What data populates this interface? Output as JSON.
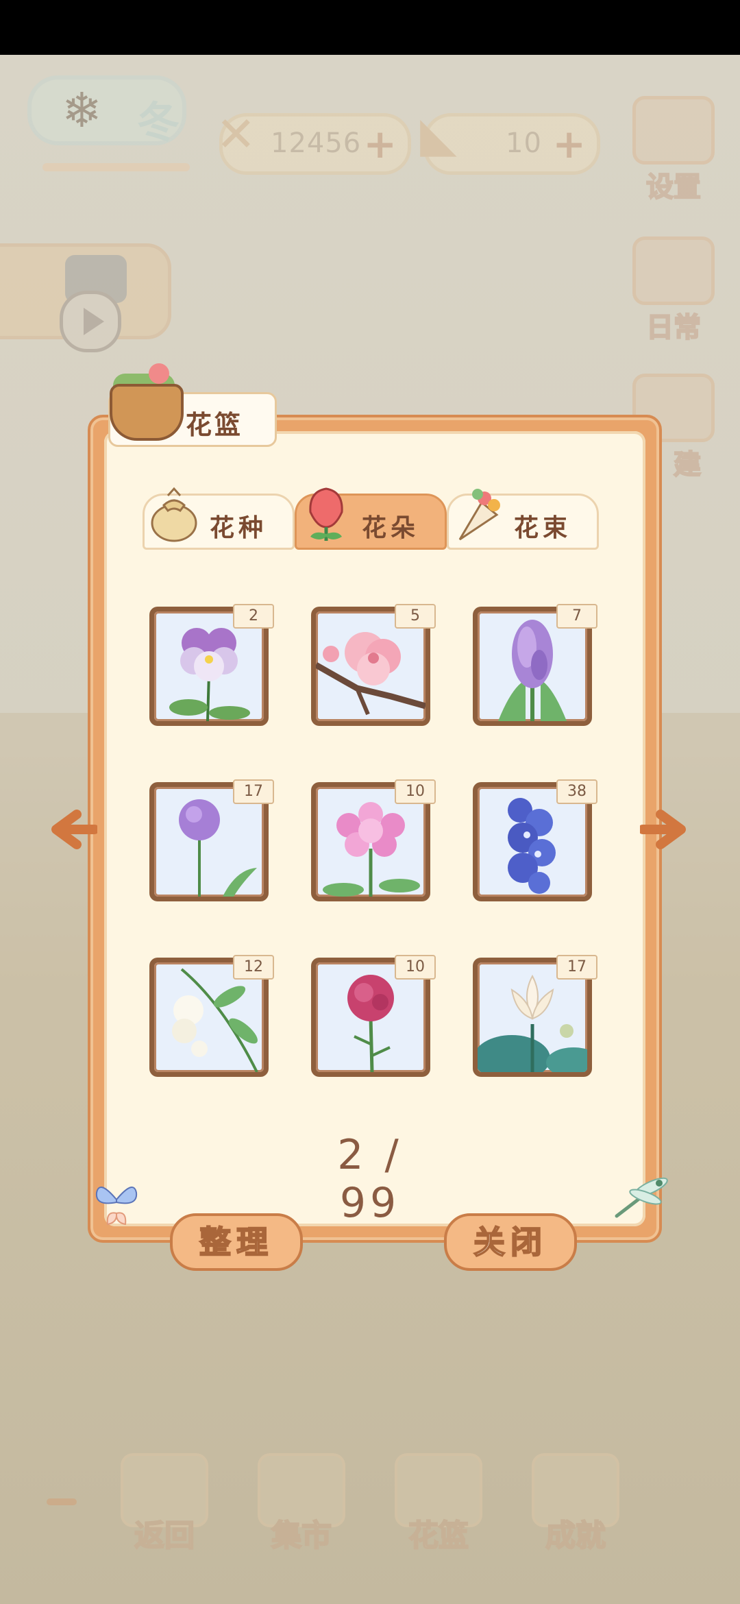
{
  "hud": {
    "season": "冬",
    "fish_count": "12456",
    "cheese_count": "10",
    "plus": "+",
    "settings": "设置",
    "daily": "日常",
    "build": "建"
  },
  "modal": {
    "title": "花篮",
    "tabs": [
      {
        "label": "花种",
        "active": false
      },
      {
        "label": "花朵",
        "active": true
      },
      {
        "label": "花束",
        "active": false
      }
    ],
    "items": [
      {
        "flower": "pansy-icon",
        "count": "2"
      },
      {
        "flower": "peach-blossom-icon",
        "count": "5"
      },
      {
        "flower": "hyacinth-icon",
        "count": "7"
      },
      {
        "flower": "allium-icon",
        "count": "17"
      },
      {
        "flower": "phlox-icon",
        "count": "10"
      },
      {
        "flower": "delphinium-icon",
        "count": "38"
      },
      {
        "flower": "gardenia-icon",
        "count": "12"
      },
      {
        "flower": "carnation-icon",
        "count": "10"
      },
      {
        "flower": "lotus-icon",
        "count": "17"
      }
    ],
    "page": "2 / 99",
    "sort_label": "整理",
    "close_label": "关闭"
  },
  "bottom_nav": [
    {
      "label": "返回"
    },
    {
      "label": "集市"
    },
    {
      "label": "花篮"
    },
    {
      "label": "成就"
    }
  ],
  "colors": {
    "modal_border": "#e9a46a",
    "panel": "#fef6e2",
    "text_brown": "#7a4a30",
    "button": "#f4b985"
  }
}
